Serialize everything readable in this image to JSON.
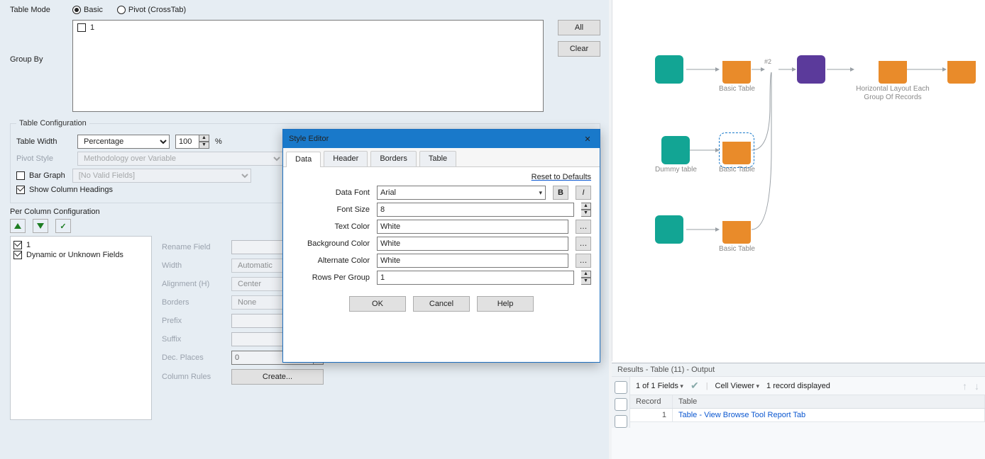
{
  "config": {
    "table_mode_label": "Table Mode",
    "radio_basic": "Basic",
    "radio_pivot": "Pivot (CrossTab)",
    "group_by_label": "Group By",
    "groupby_item": "1",
    "btn_all": "All",
    "btn_clear": "Clear",
    "section_table_config": "Table Configuration",
    "table_width_label": "Table Width",
    "table_width_value": "Percentage",
    "table_width_num": "100",
    "table_width_unit": "%",
    "pivot_style_label": "Pivot Style",
    "pivot_style_value": "Methodology over Variable",
    "bar_graph_label": "Bar Graph",
    "bar_graph_value": "[No Valid Fields]",
    "show_col_headings": "Show Column Headings",
    "section_percol": "Per Column Configuration",
    "col_list": [
      "1",
      "Dynamic or Unknown Fields"
    ],
    "rename_field": "Rename Field",
    "width_label": "Width",
    "width_value": "Automatic",
    "align_label": "Alignment (H)",
    "align_value": "Center",
    "borders_label": "Borders",
    "borders_value": "None",
    "prefix_label": "Prefix",
    "suffix_label": "Suffix",
    "decplaces_label": "Dec. Places",
    "decplaces_value": "0",
    "colrules_label": "Column Rules",
    "colrules_btn": "Create..."
  },
  "modal": {
    "title": "Style Editor",
    "tabs": [
      "Data",
      "Header",
      "Borders",
      "Table"
    ],
    "reset_link": "Reset to Defaults",
    "rows": {
      "data_font_lbl": "Data Font",
      "data_font_val": "Arial",
      "font_size_lbl": "Font Size",
      "font_size_val": "8",
      "text_color_lbl": "Text Color",
      "text_color_val": "White",
      "bg_color_lbl": "Background Color",
      "bg_color_val": "White",
      "alt_color_lbl": "Alternate Color",
      "alt_color_val": "White",
      "rows_per_grp_lbl": "Rows Per Group",
      "rows_per_grp_val": "1"
    },
    "ok": "OK",
    "cancel": "Cancel",
    "help": "Help"
  },
  "canvas": {
    "nodes": {
      "bt1": "Basic Table",
      "bt2": "Basic Table",
      "bt3": "Basic Table",
      "dummy": "Dummy table",
      "anchor": "#2",
      "layout": "Horizontal Layout Each Group Of Records"
    }
  },
  "results": {
    "title": "Results - Table (11) - Output",
    "fields_count": "1 of 1 Fields",
    "cell_viewer": "Cell Viewer",
    "records": "1 record displayed",
    "col_record": "Record",
    "col_table": "Table",
    "row_record": "1",
    "row_table": "Table - View Browse Tool Report Tab"
  }
}
